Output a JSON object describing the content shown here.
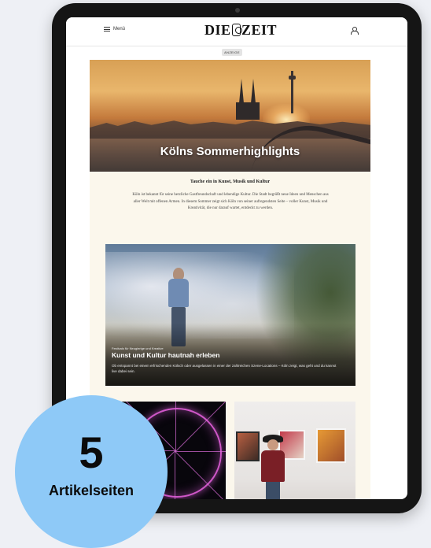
{
  "header": {
    "menu_label": "Menü",
    "logo_left": "DIE",
    "logo_right": "ZEIT",
    "account_icon": "user-icon"
  },
  "ad_label": "ANZEIGE",
  "hero": {
    "title": "Kölns Sommerhighlights"
  },
  "intro": {
    "heading": "Tauche ein in Kunst, Musik und Kultur",
    "text": "Köln ist bekannt für seine herzliche Gastfreundschaft und lebendige Kultur. Die Stadt begrüßt neue Ideen und Menschen aus aller Welt mit offenen Armen. In diesem Sommer zeigt sich Köln von seiner aufregendsten Seite – voller Kunst, Musik und Kreativität, die nur darauf wartet, entdeckt zu werden."
  },
  "feature": {
    "kicker": "Festivals für Neugierige und Kreative",
    "title": "Kunst und Kultur hautnah erleben",
    "description": "Ob entspannt bei einem erfrischenden Kölsch oder ausgelassen in einer der zahlreichen Szene-Locations – Köln zeigt, was geht und du kannst live dabei sein."
  },
  "badge": {
    "number": "5",
    "label": "Artikelseiten",
    "color": "#8ec9f7"
  }
}
